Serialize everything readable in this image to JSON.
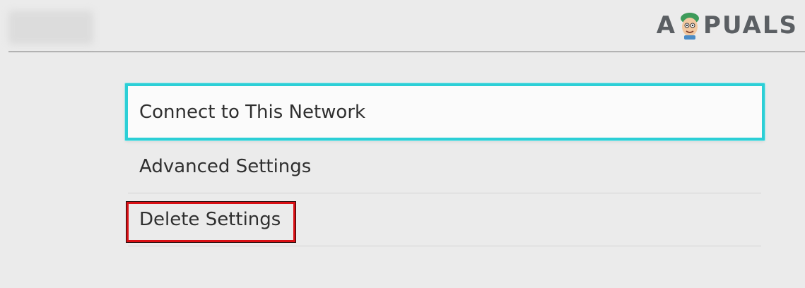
{
  "header": {
    "watermark": {
      "letter_a": "A",
      "letters_rest": "PUALS",
      "mascot_icon": "appuals-mascot-icon"
    }
  },
  "menu": {
    "items": [
      {
        "label": "Connect to This Network",
        "state": "selected"
      },
      {
        "label": "Advanced Settings",
        "state": "normal"
      },
      {
        "label": "Delete Settings",
        "state": "annotated"
      }
    ]
  },
  "colors": {
    "background": "#ebebeb",
    "selection_border": "#2ccfd6",
    "annotation_border": "#d90f14"
  }
}
